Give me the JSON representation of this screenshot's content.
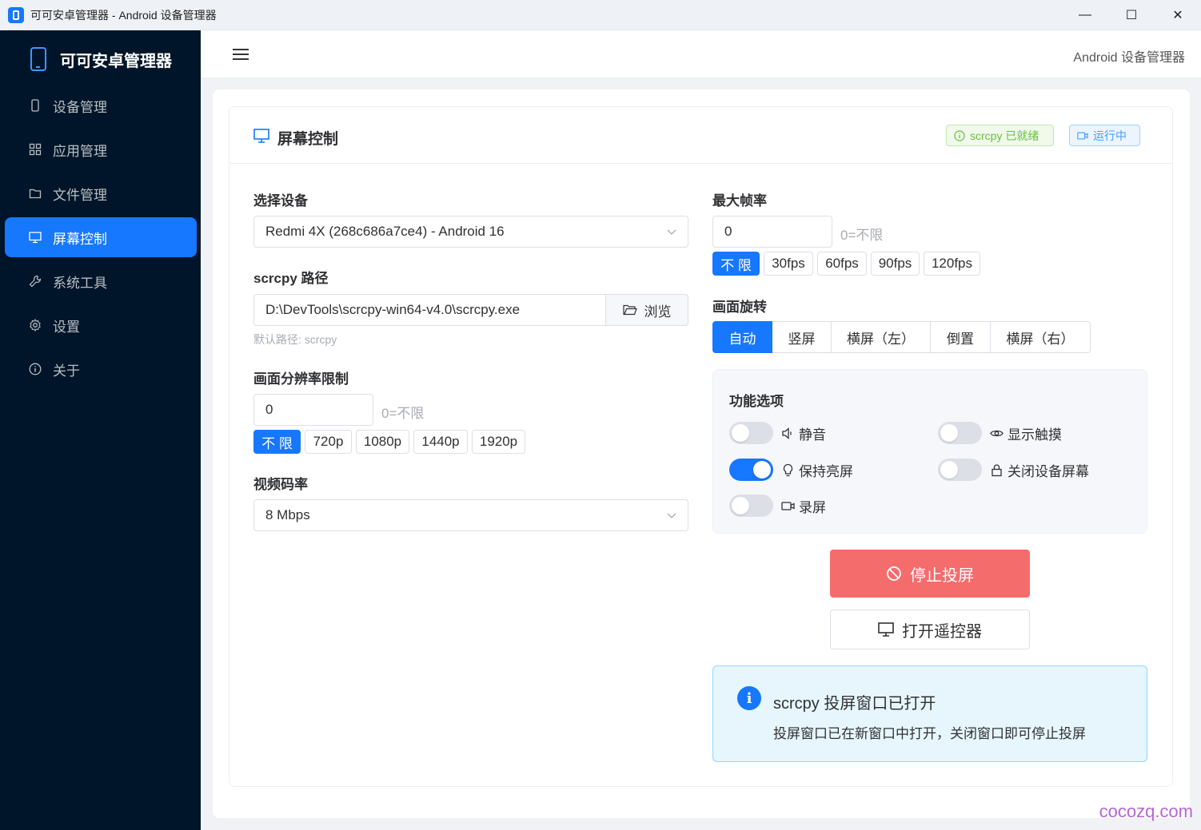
{
  "window": {
    "title": "可可安卓管理器 - Android 设备管理器",
    "minimize": "—",
    "maximize": "☐",
    "close": "✕"
  },
  "sidebar": {
    "brand": "可可安卓管理器",
    "items": [
      {
        "label": "设备管理",
        "icon": "phone-icon"
      },
      {
        "label": "应用管理",
        "icon": "grid-icon"
      },
      {
        "label": "文件管理",
        "icon": "folder-icon"
      },
      {
        "label": "屏幕控制",
        "icon": "monitor-icon",
        "active": true
      },
      {
        "label": "系统工具",
        "icon": "wrench-icon"
      },
      {
        "label": "设置",
        "icon": "gear-icon"
      },
      {
        "label": "关于",
        "icon": "info-icon"
      }
    ]
  },
  "header": {
    "title": "Android 设备管理器"
  },
  "card": {
    "title": "屏幕控制",
    "tags": {
      "ready": "scrcpy 已就绪",
      "running": "运行中"
    }
  },
  "form": {
    "device": {
      "label": "选择设备",
      "value": "Redmi 4X (268c686a7ce4) - Android 16"
    },
    "scrcpy_path": {
      "label": "scrcpy 路径",
      "value": "D:\\DevTools\\scrcpy-win64-v4.0\\scrcpy.exe",
      "browse": "浏览",
      "hint": "默认路径: scrcpy"
    },
    "resolution": {
      "label": "画面分辨率限制",
      "value": "0",
      "hint": "0=不限",
      "presets": [
        "不 限",
        "720p",
        "1080p",
        "1440p",
        "1920p"
      ],
      "selected": 0
    },
    "bitrate": {
      "label": "视频码率",
      "value": "8 Mbps"
    },
    "max_fps": {
      "label": "最大帧率",
      "value": "0",
      "hint": "0=不限",
      "presets": [
        "不 限",
        "30fps",
        "60fps",
        "90fps",
        "120fps"
      ],
      "selected": 0
    },
    "rotation": {
      "label": "画面旋转",
      "options": [
        "自动",
        "竖屏",
        "横屏（左）",
        "倒置",
        "横屏（右）"
      ],
      "selected": 0
    },
    "features": {
      "title": "功能选项",
      "items": [
        {
          "label": "静音",
          "icon": "volume-icon",
          "on": false
        },
        {
          "label": "显示触摸",
          "icon": "eye-icon",
          "on": false
        },
        {
          "label": "保持亮屏",
          "icon": "bulb-icon",
          "on": true
        },
        {
          "label": "关闭设备屏幕",
          "icon": "lock-icon",
          "on": false
        },
        {
          "label": "录屏",
          "icon": "camera-icon",
          "on": false
        }
      ]
    }
  },
  "actions": {
    "stop": "停止投屏",
    "remote": "打开遥控器"
  },
  "alert": {
    "title": "scrcpy 投屏窗口已打开",
    "desc": "投屏窗口已在新窗口中打开，关闭窗口即可停止投屏"
  },
  "watermark": "cocozq.com",
  "colors": {
    "primary": "#1677ff",
    "sidebar_bg": "#001529",
    "danger": "#f56c6c",
    "success": "#67c23a"
  }
}
